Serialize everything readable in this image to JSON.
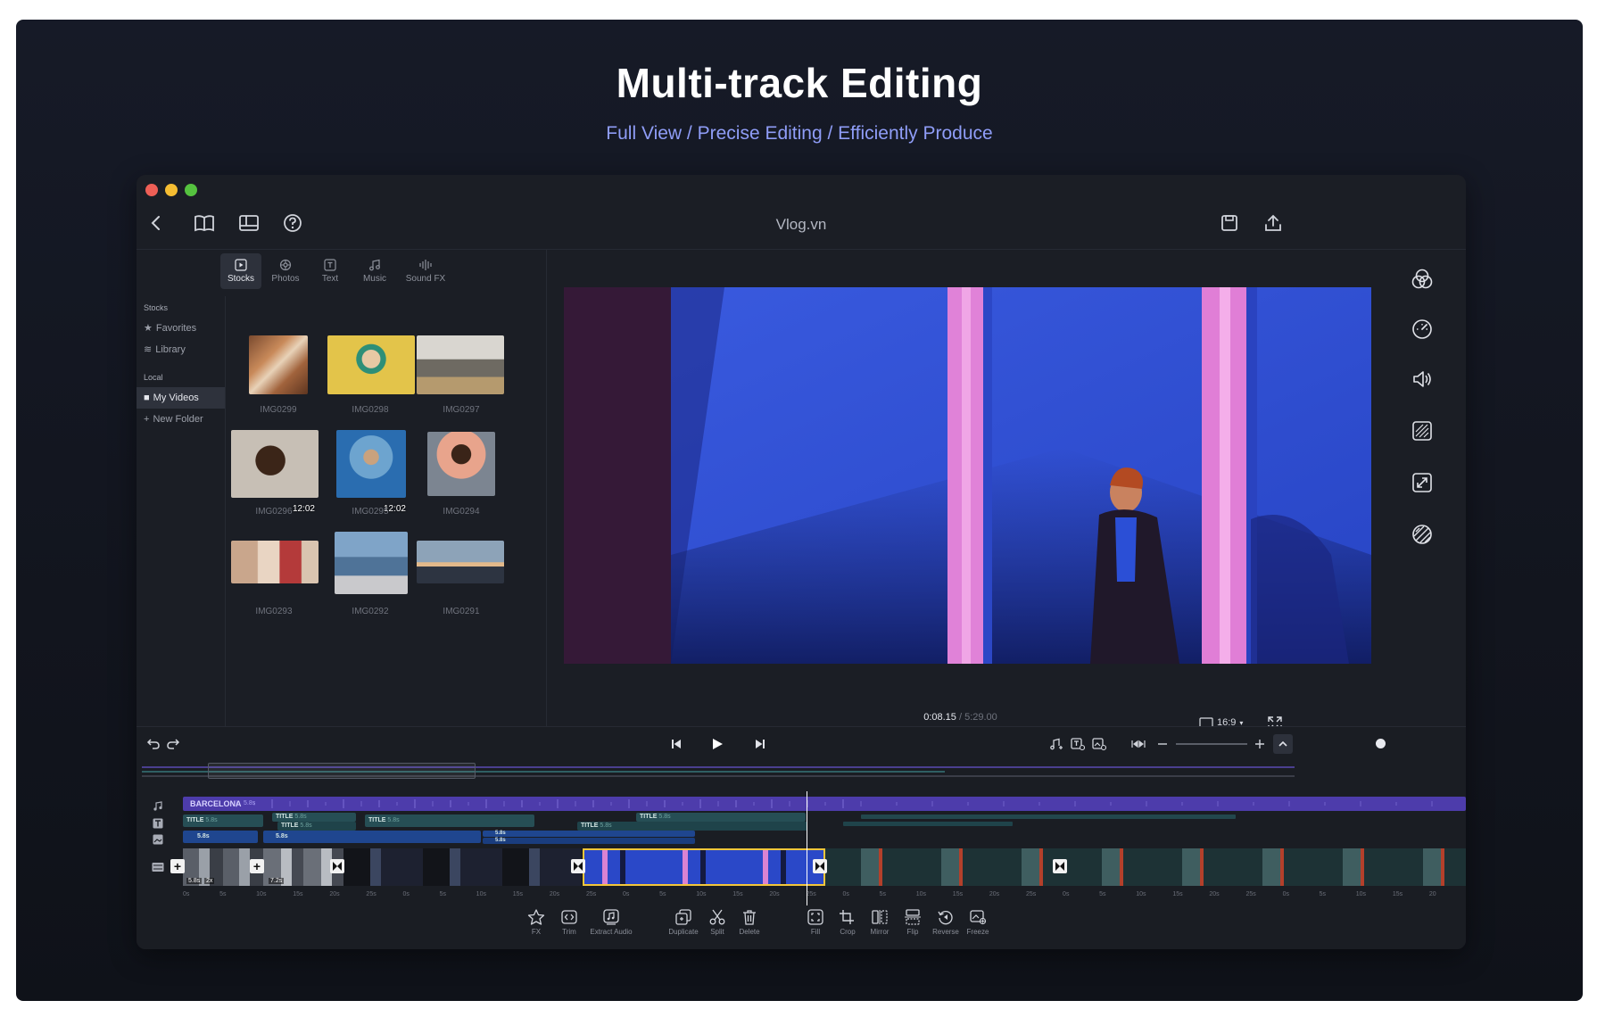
{
  "hero": {
    "title": "Multi-track Editing",
    "subtitle": "Full View / Precise Editing / Efficiently Produce"
  },
  "window": {
    "title": "Vlog.vn",
    "traffic_lights": [
      "#ee5f56",
      "#f5bd32",
      "#55c23f"
    ]
  },
  "toolbar": {
    "left_icons": [
      "back-icon",
      "book-icon",
      "layout-icon",
      "help-icon"
    ],
    "right_icons": [
      "save-icon",
      "export-icon"
    ]
  },
  "media": {
    "tabs": [
      {
        "label": "Stocks",
        "icon": "stocks-icon",
        "active": true
      },
      {
        "label": "Photos",
        "icon": "photos-icon"
      },
      {
        "label": "Text",
        "icon": "text-icon"
      },
      {
        "label": "Music",
        "icon": "music-icon"
      },
      {
        "label": "Sound FX",
        "icon": "soundfx-icon"
      }
    ],
    "sidebar": {
      "stocks_heading": "Stocks",
      "favorites": "Favorites",
      "library": "Library",
      "local_heading": "Local",
      "my_videos": "My Videos",
      "new_folder": "New Folder"
    },
    "items": [
      {
        "name": "IMG0299"
      },
      {
        "name": "IMG0298"
      },
      {
        "name": "IMG0297"
      },
      {
        "name": "IMG0296",
        "duration": "12:02"
      },
      {
        "name": "IMG0295",
        "duration": "12:02"
      },
      {
        "name": "IMG0294"
      },
      {
        "name": "IMG0293"
      },
      {
        "name": "IMG0292"
      },
      {
        "name": "IMG0291"
      }
    ]
  },
  "preview": {
    "current_time": "0:08.15",
    "separator": "/",
    "total_time": "5:29.00",
    "aspect_ratio": "16:9"
  },
  "right_panel_icons": [
    "color-icon",
    "speed-icon",
    "volume-icon",
    "filter-icon",
    "resize-icon",
    "mask-icon"
  ],
  "timeline": {
    "audio_clip_label": "BARCELONA",
    "audio_clip_duration": "5.8s",
    "title_clips": [
      {
        "label": "TITLE",
        "duration": "5.8s"
      },
      {
        "label": "TITLE",
        "duration": "5.8s"
      },
      {
        "label": "TITLE",
        "duration": "5.8s"
      },
      {
        "label": "TITLE",
        "duration": "5.8s"
      },
      {
        "label": "TITLE",
        "duration": "5.8s"
      },
      {
        "label": "TITLE",
        "duration": "5.8s"
      }
    ],
    "sticker_clips": [
      {
        "label": "5.8s"
      },
      {
        "label": "5.8s"
      },
      {
        "label": "5.8s"
      },
      {
        "label": "5.8s"
      }
    ],
    "first_clip_badges": [
      "5.8s",
      "2x"
    ],
    "second_clip_badge": "7.2s",
    "ruler_labels": [
      "0s",
      "5s",
      "10s",
      "15s",
      "20s",
      "25s",
      "0s",
      "5s",
      "10s",
      "15s",
      "20s",
      "25s",
      "0s",
      "5s",
      "10s",
      "15s",
      "20s",
      "25s",
      "0s",
      "5s",
      "10s",
      "15s",
      "20s",
      "25s",
      "0s",
      "5s",
      "10s",
      "15s",
      "20s",
      "25s",
      "0s",
      "5s",
      "10s",
      "15s",
      "20"
    ],
    "tools": [
      {
        "label": "FX",
        "icon": "fx-icon"
      },
      {
        "label": "Trim",
        "icon": "trim-icon"
      },
      {
        "label": "Extract Audio",
        "icon": "extract-audio-icon"
      },
      {
        "label": "Duplicate",
        "icon": "duplicate-icon"
      },
      {
        "label": "Split",
        "icon": "split-icon"
      },
      {
        "label": "Delete",
        "icon": "delete-icon"
      },
      {
        "label": "Fill",
        "icon": "fill-icon"
      },
      {
        "label": "Crop",
        "icon": "crop-icon"
      },
      {
        "label": "Mirror",
        "icon": "mirror-icon"
      },
      {
        "label": "Flip",
        "icon": "flip-icon"
      },
      {
        "label": "Reverse",
        "icon": "reverse-icon"
      },
      {
        "label": "Freeze",
        "icon": "freeze-icon"
      }
    ],
    "zoom_level": 0.5
  }
}
